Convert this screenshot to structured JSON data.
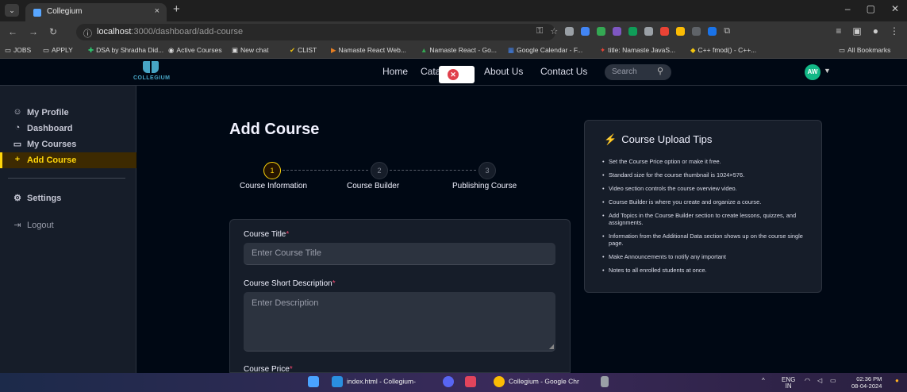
{
  "browser": {
    "tab_title": "Collegium",
    "tab_close": "×",
    "new_tab": "+",
    "url_host": "localhost",
    "url_path": ":3000/dashboard/add-course",
    "window_controls": [
      "–",
      "▢",
      "✕"
    ]
  },
  "bookmarks": [
    {
      "label": "JOBS"
    },
    {
      "label": "APPLY"
    },
    {
      "label": "DSA by Shradha Did..."
    },
    {
      "label": "Active Courses"
    },
    {
      "label": "New chat"
    },
    {
      "label": "CLIST"
    },
    {
      "label": "Namaste React Web..."
    },
    {
      "label": "Namaste React - Go..."
    },
    {
      "label": "Google Calendar - F..."
    },
    {
      "label": "title: Namaste JavaS..."
    },
    {
      "label": "C++ fmod() - C++..."
    },
    {
      "label": "All Bookmarks"
    }
  ],
  "app": {
    "logo_text": "COLLEGIUM",
    "nav": {
      "home": "Home",
      "catalog": "Cata",
      "about": "About Us",
      "contact": "Contact Us",
      "search_placeholder": "Search"
    },
    "avatar_initials": "AW"
  },
  "sidebar": {
    "items": [
      {
        "label": "My Profile",
        "icon": "user-icon"
      },
      {
        "label": "Dashboard",
        "icon": "dashboard-icon"
      },
      {
        "label": "My Courses",
        "icon": "monitor-icon"
      },
      {
        "label": "Add Course",
        "icon": "plus-icon",
        "active": true
      },
      {
        "label": "Settings",
        "icon": "gear-icon"
      },
      {
        "label": "Logout",
        "icon": "logout-icon"
      }
    ]
  },
  "main": {
    "title": "Add Course",
    "steps": [
      {
        "number": "1",
        "label": "Course Information",
        "active": true
      },
      {
        "number": "2",
        "label": "Course Builder",
        "active": false
      },
      {
        "number": "3",
        "label": "Publishing Course",
        "active": false
      }
    ],
    "form": {
      "course_title_label": "Course Title",
      "course_title_placeholder": "Enter Course Title",
      "short_desc_label": "Course Short Description",
      "short_desc_placeholder": "Enter Description",
      "price_label": "Course Price",
      "required_marker": "*"
    }
  },
  "tips": {
    "title": "Course Upload Tips",
    "items": [
      "Set the Course Price option or make it free.",
      "Standard size for the course thumbnail is 1024×576.",
      "Video section controls the course overview video.",
      "Course Builder is where you create and organize a course.",
      "Add Topics in the Course Builder section to create lessons, quizzes, and assignments.",
      "Information from the Additional Data section shows up on the course single page.",
      "Make Announcements to notify any important",
      "Notes to all enrolled students at once."
    ]
  },
  "taskbar": {
    "vscode_label": "index.html - Collegium-",
    "chrome_label": "Collegium - Google Chr",
    "lang": "ENG",
    "region": "IN",
    "time": "02:36 PM",
    "date": "08-04-2024"
  },
  "colors": {
    "accent": "#ffd60a",
    "background": "#000814",
    "card": "#161d29",
    "required": "#ef476f"
  }
}
